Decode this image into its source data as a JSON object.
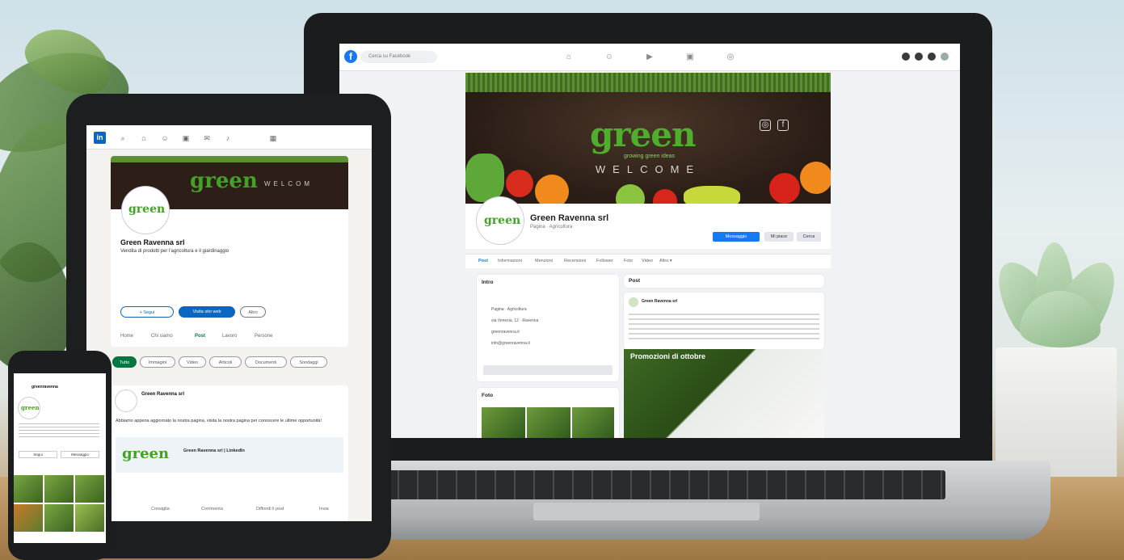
{
  "laptop": {
    "search_placeholder": "Cerca su Facebook",
    "brand": "green",
    "brand_tagline": "growing green ideas",
    "cover_welcome": "WELCOME",
    "page_name": "Green Ravenna srl",
    "page_meta": "Pagina · Agricoltura",
    "btn_primary": "Messaggio",
    "btn_like": "Mi piace",
    "btn_search": "Cerca",
    "tabs": [
      "Post",
      "Informazioni",
      "Menzioni",
      "Recensioni",
      "Follower",
      "Foto",
      "Video",
      "Altro ▾"
    ],
    "intro_title": "Intro",
    "intro_lines": [
      "Pagina · Agricoltura",
      "via Venezia, 12 · Ravenna",
      "greenravenna.it",
      "info@greenravenna.it"
    ],
    "photos_title": "Foto",
    "posts_title": "Post",
    "post_author": "Green Ravenna srl",
    "post_headline": "Promozioni di ottobre"
  },
  "tablet": {
    "logo": "in",
    "brand": "green",
    "cover_text": "WELCOM",
    "company_name": "Green Ravenna srl",
    "description": "Vendita di prodotti per l'agricoltura e il giardinaggio",
    "follow_btn": "+ Segui",
    "visit_btn": "Visita sito web",
    "more_btn": "Altro",
    "tabs": [
      "Home",
      "Chi siamo",
      "Post",
      "Lavoro",
      "Persone"
    ],
    "chips": [
      "Tutto",
      "Immagini",
      "Video",
      "Articoli",
      "Documenti",
      "Sondaggi"
    ],
    "post_author": "Green Ravenna srl",
    "post_text": "Abbiamo appena aggiornato la nostra pagina, visita la nostra pagina per conoscere le ultime opportunità!",
    "link_title": "Green Ravenna srl | LinkedIn",
    "actions": [
      "Consiglia",
      "Commenta",
      "Diffondi il post",
      "Invia"
    ]
  },
  "phone": {
    "username": "greenravenna",
    "brand": "green",
    "follow_btn": "Segui",
    "message_btn": "Messaggio"
  },
  "colors": {
    "facebook_blue": "#1877f2",
    "linkedin_blue": "#0a66c2",
    "brand_green": "#4fae2e"
  }
}
